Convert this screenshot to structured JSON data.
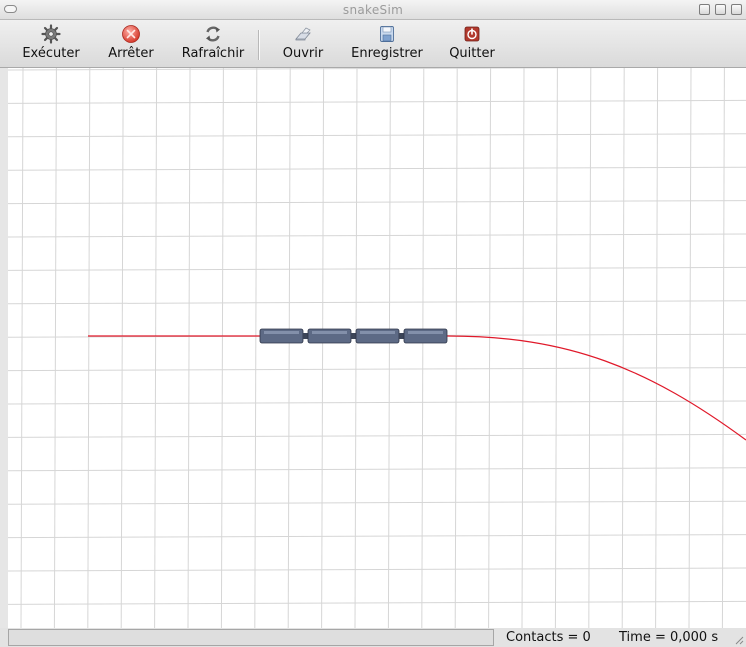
{
  "window": {
    "title": "snakeSim"
  },
  "toolbar": {
    "buttons": [
      {
        "label": "Exécuter",
        "icon": "gear-icon"
      },
      {
        "label": "Arrêter",
        "icon": "stop-icon"
      },
      {
        "label": "Rafraîchir",
        "icon": "refresh-icon"
      },
      {
        "label": "Ouvrir",
        "icon": "open-icon"
      },
      {
        "label": "Enregistrer",
        "icon": "save-icon"
      },
      {
        "label": "Quitter",
        "icon": "quit-icon"
      }
    ]
  },
  "simulation": {
    "path_color": "#e0192a",
    "segment_color": "#5d6a85",
    "segment_count": 4
  },
  "status": {
    "contacts": "Contacts = 0",
    "time": "Time = 0,000 s"
  },
  "colors": {
    "grid_line": "#d6d6d6",
    "canvas_bg": "#ffffff"
  }
}
